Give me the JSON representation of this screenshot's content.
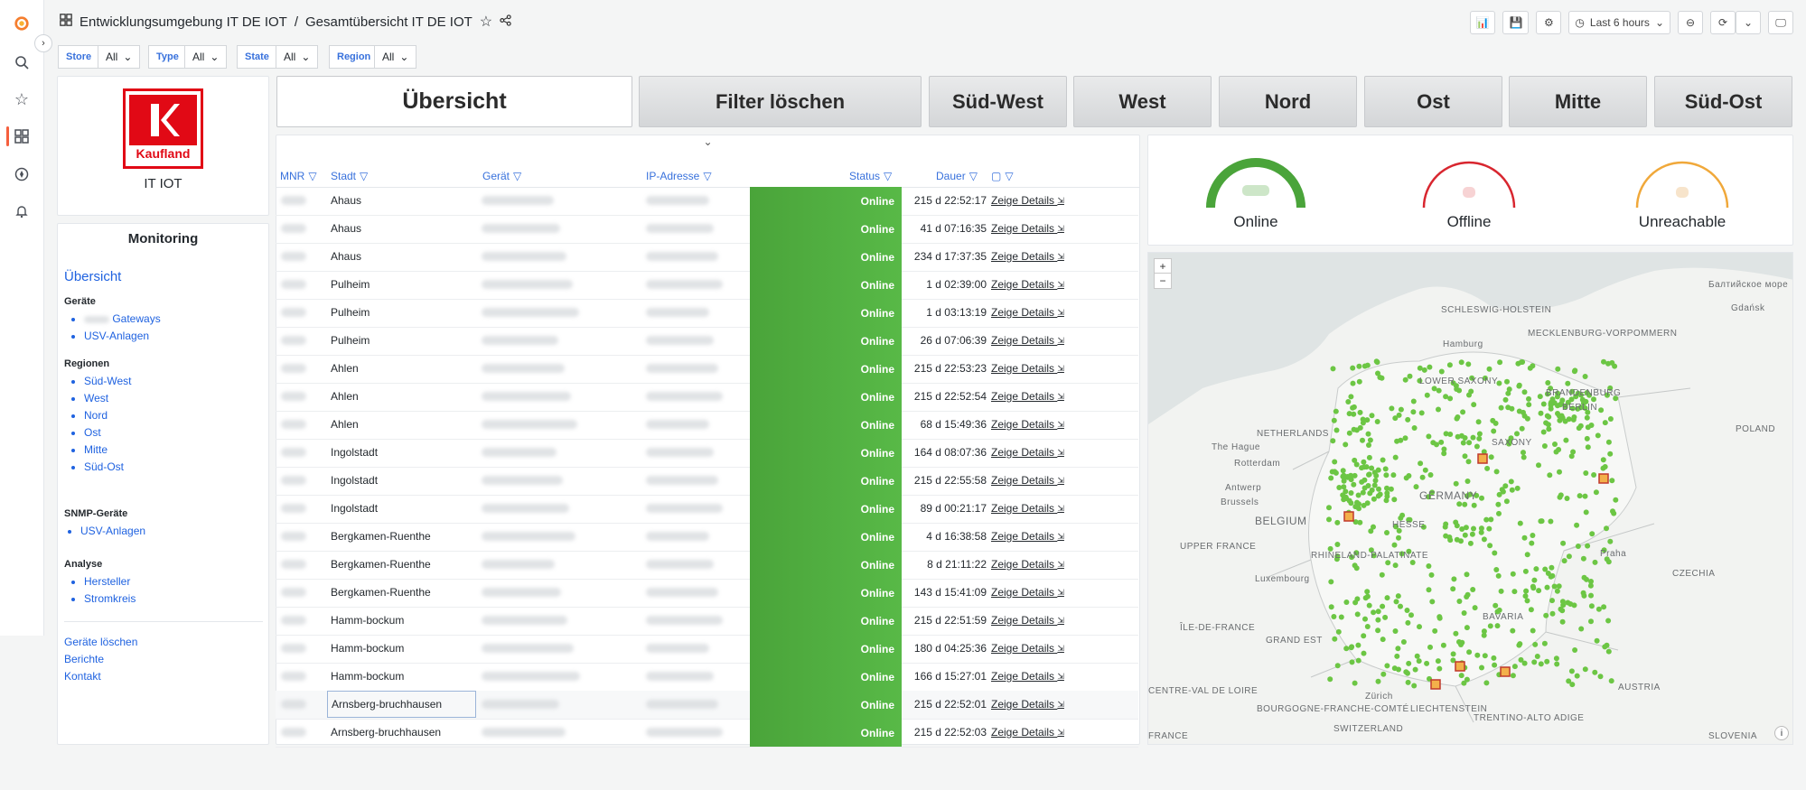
{
  "breadcrumb": {
    "folder": "Entwicklungsumgebung IT DE IOT",
    "separator": "/",
    "dashboard": "Gesamtübersicht IT DE IOT"
  },
  "toolbar": {
    "time_range": "Last 6 hours"
  },
  "variables": [
    {
      "label": "Store",
      "value": "All"
    },
    {
      "label": "Type",
      "value": "All"
    },
    {
      "label": "State",
      "value": "All"
    },
    {
      "label": "Region",
      "value": "All"
    }
  ],
  "logo": {
    "brand": "Kaufland",
    "caption": "IT IOT"
  },
  "buttons": [
    "Übersicht",
    "Filter löschen",
    "Süd-West",
    "West",
    "Nord",
    "Ost",
    "Mitte",
    "Süd-Ost"
  ],
  "sidebar": {
    "title": "Monitoring",
    "overview_link": "Übersicht",
    "geraete_title": "Geräte",
    "geraete": [
      "Gateways",
      "USV-Anlagen"
    ],
    "regionen_title": "Regionen",
    "regionen": [
      "Süd-West",
      "West",
      "Nord",
      "Ost",
      "Mitte",
      "Süd-Ost"
    ],
    "snmp_title": "SNMP-Geräte",
    "snmp": [
      "USV-Anlagen"
    ],
    "analyse_title": "Analyse",
    "analyse": [
      "Hersteller",
      "Stromkreis"
    ],
    "footer_links": [
      "Geräte löschen",
      "Berichte",
      "Kontakt"
    ]
  },
  "table": {
    "columns": [
      "MNR",
      "Stadt",
      "Gerät",
      "IP-Adresse",
      "Status",
      "Dauer"
    ],
    "rows": [
      {
        "stadt": "Ahaus",
        "status": "Online",
        "dauer": "215 d 22:52:17",
        "details": "Zeige Details"
      },
      {
        "stadt": "Ahaus",
        "status": "Online",
        "dauer": "41 d 07:16:35",
        "details": "Zeige Details"
      },
      {
        "stadt": "Ahaus",
        "status": "Online",
        "dauer": "234 d 17:37:35",
        "details": "Zeige Details"
      },
      {
        "stadt": "Pulheim",
        "status": "Online",
        "dauer": "1 d 02:39:00",
        "details": "Zeige Details"
      },
      {
        "stadt": "Pulheim",
        "status": "Online",
        "dauer": "1 d 03:13:19",
        "details": "Zeige Details"
      },
      {
        "stadt": "Pulheim",
        "status": "Online",
        "dauer": "26 d 07:06:39",
        "details": "Zeige Details"
      },
      {
        "stadt": "Ahlen",
        "status": "Online",
        "dauer": "215 d 22:53:23",
        "details": "Zeige Details"
      },
      {
        "stadt": "Ahlen",
        "status": "Online",
        "dauer": "215 d 22:52:54",
        "details": "Zeige Details"
      },
      {
        "stadt": "Ahlen",
        "status": "Online",
        "dauer": "68 d 15:49:36",
        "details": "Zeige Details"
      },
      {
        "stadt": "Ingolstadt",
        "status": "Online",
        "dauer": "164 d 08:07:36",
        "details": "Zeige Details"
      },
      {
        "stadt": "Ingolstadt",
        "status": "Online",
        "dauer": "215 d 22:55:58",
        "details": "Zeige Details"
      },
      {
        "stadt": "Ingolstadt",
        "status": "Online",
        "dauer": "89 d 00:21:17",
        "details": "Zeige Details"
      },
      {
        "stadt": "Bergkamen-Ruenthe",
        "status": "Online",
        "dauer": "4 d 16:38:58",
        "details": "Zeige Details"
      },
      {
        "stadt": "Bergkamen-Ruenthe",
        "status": "Online",
        "dauer": "8 d 21:11:22",
        "details": "Zeige Details"
      },
      {
        "stadt": "Bergkamen-Ruenthe",
        "status": "Online",
        "dauer": "143 d 15:41:09",
        "details": "Zeige Details"
      },
      {
        "stadt": "Hamm-bockum",
        "status": "Online",
        "dauer": "215 d 22:51:59",
        "details": "Zeige Details"
      },
      {
        "stadt": "Hamm-bockum",
        "status": "Online",
        "dauer": "180 d 04:25:36",
        "details": "Zeige Details"
      },
      {
        "stadt": "Hamm-bockum",
        "status": "Online",
        "dauer": "166 d 15:27:01",
        "details": "Zeige Details"
      },
      {
        "stadt": "Arnsberg-bruchhausen",
        "status": "Online",
        "dauer": "215 d 22:52:01",
        "details": "Zeige Details"
      },
      {
        "stadt": "Arnsberg-bruchhausen",
        "status": "Online",
        "dauer": "215 d 22:52:03",
        "details": "Zeige Details"
      }
    ]
  },
  "gauges": [
    {
      "label": "Online",
      "color": "#4aa43a",
      "fraction": 1.0
    },
    {
      "label": "Offline",
      "color": "#d8262f",
      "fraction": 0.0
    },
    {
      "label": "Unreachable",
      "color": "#f0a83a",
      "fraction": 0.0
    }
  ],
  "map": {
    "labels": [
      "SCHLESWIG-HOLSTEIN",
      "MECKLENBURG-VORPOMMERN",
      "Hamburg",
      "LOWER SAXONY",
      "BRANDENBURG",
      "BERLIN",
      "NETHERLANDS",
      "The Hague",
      "Rotterdam",
      "Antwerp",
      "Brussels",
      "BELGIUM",
      "SAXONY",
      "GERMANY",
      "HESSE",
      "RHINELAND-PALATINATE",
      "Luxembourg",
      "UPPER FRANCE",
      "BAVARIA",
      "Praha",
      "CZECHIA",
      "ÎLE-DE-FRANCE",
      "GRAND EST",
      "Zürich",
      "AUSTRIA",
      "BOURGOGNE-FRANCHE-COMTÉ",
      "SWITZERLAND",
      "LIECHTENSTEIN",
      "TRENTINO-ALTO ADIGE",
      "FRANCE",
      "POLAND",
      "Gdańsk",
      "Балтийское море",
      "CENTRE-VAL DE LOIRE",
      "SLOVENIA"
    ],
    "point_color": "#6cc644"
  }
}
